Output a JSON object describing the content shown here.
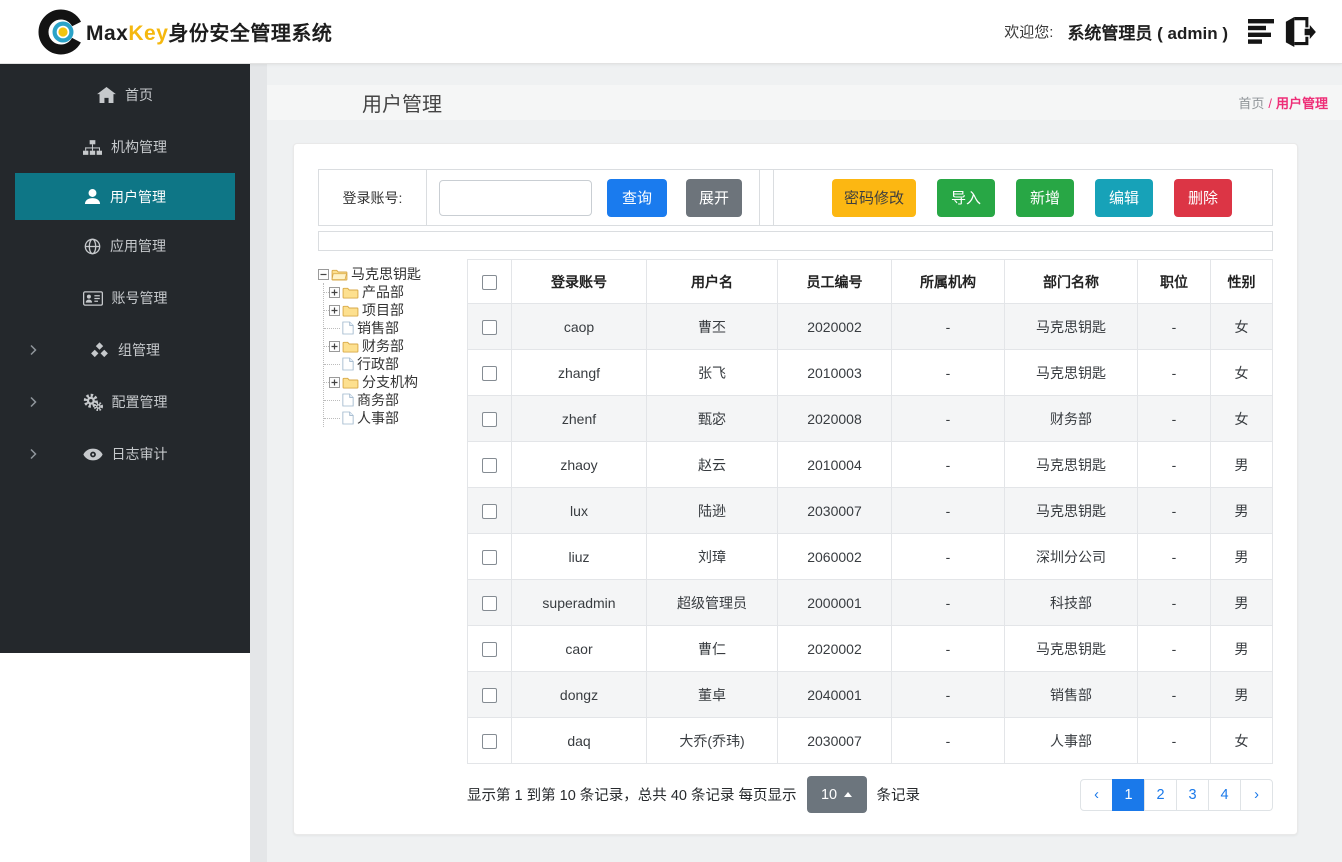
{
  "header": {
    "brand_max": "Max",
    "brand_key": "Key",
    "brand_suffix": "身份安全管理系统",
    "welcome": "欢迎您:",
    "user": "系统管理员 ( admin )"
  },
  "sidebar": {
    "items": [
      {
        "id": "home",
        "label": "首页",
        "icon": "home",
        "active": false,
        "expandable": false
      },
      {
        "id": "org",
        "label": "机构管理",
        "icon": "sitemap",
        "active": false,
        "expandable": false
      },
      {
        "id": "user",
        "label": "用户管理",
        "icon": "user",
        "active": true,
        "expandable": false
      },
      {
        "id": "app",
        "label": "应用管理",
        "icon": "globe",
        "active": false,
        "expandable": false
      },
      {
        "id": "account",
        "label": "账号管理",
        "icon": "idcard",
        "active": false,
        "expandable": false
      },
      {
        "id": "group",
        "label": "组管理",
        "icon": "cubes",
        "active": false,
        "expandable": true
      },
      {
        "id": "config",
        "label": "配置管理",
        "icon": "gears",
        "active": false,
        "expandable": true
      },
      {
        "id": "audit",
        "label": "日志审计",
        "icon": "eye",
        "active": false,
        "expandable": true
      }
    ]
  },
  "page": {
    "title": "用户管理",
    "breadcrumb_home": "首页",
    "breadcrumb_sep": "/",
    "breadcrumb_current": "用户管理"
  },
  "filter": {
    "label": "登录账号:",
    "search_value": "",
    "query_label": "查询",
    "expand_label": "展开",
    "actions": [
      {
        "id": "change-password",
        "label": "密码修改",
        "bg": "#fcb712",
        "fg": "#3f3f3f"
      },
      {
        "id": "import",
        "label": "导入",
        "bg": "#28a745",
        "fg": "#ffffff"
      },
      {
        "id": "add",
        "label": "新增",
        "bg": "#28a745",
        "fg": "#ffffff"
      },
      {
        "id": "edit",
        "label": "编辑",
        "bg": "#17a2b8",
        "fg": "#ffffff"
      },
      {
        "id": "delete",
        "label": "删除",
        "bg": "#dc3545",
        "fg": "#ffffff"
      }
    ]
  },
  "tree": {
    "root": {
      "label": "马克思钥匙",
      "expander": "minus",
      "icon": "folder-open"
    },
    "children": [
      {
        "label": "产品部",
        "expander": "plus",
        "icon": "folder"
      },
      {
        "label": "项目部",
        "expander": "plus",
        "icon": "folder"
      },
      {
        "label": "销售部",
        "expander": null,
        "icon": "file"
      },
      {
        "label": "财务部",
        "expander": "plus",
        "icon": "folder"
      },
      {
        "label": "行政部",
        "expander": null,
        "icon": "file"
      },
      {
        "label": "分支机构",
        "expander": "plus",
        "icon": "folder"
      },
      {
        "label": "商务部",
        "expander": null,
        "icon": "file"
      },
      {
        "label": "人事部",
        "expander": null,
        "icon": "file"
      }
    ]
  },
  "table": {
    "columns": [
      "登录账号",
      "用户名",
      "员工编号",
      "所属机构",
      "部门名称",
      "职位",
      "性别"
    ],
    "rows": [
      [
        "caop",
        "曹丕",
        "2020002",
        "-",
        "马克思钥匙",
        "-",
        "女"
      ],
      [
        "zhangf",
        "张飞",
        "2010003",
        "-",
        "马克思钥匙",
        "-",
        "女"
      ],
      [
        "zhenf",
        "甄宓",
        "2020008",
        "-",
        "财务部",
        "-",
        "女"
      ],
      [
        "zhaoy",
        "赵云",
        "2010004",
        "-",
        "马克思钥匙",
        "-",
        "男"
      ],
      [
        "lux",
        "陆逊",
        "2030007",
        "-",
        "马克思钥匙",
        "-",
        "男"
      ],
      [
        "liuz",
        "刘璋",
        "2060002",
        "-",
        "深圳分公司",
        "-",
        "男"
      ],
      [
        "superadmin",
        "超级管理员",
        "2000001",
        "-",
        "科技部",
        "-",
        "男"
      ],
      [
        "caor",
        "曹仁",
        "2020002",
        "-",
        "马克思钥匙",
        "-",
        "男"
      ],
      [
        "dongz",
        "董卓",
        "2040001",
        "-",
        "销售部",
        "-",
        "男"
      ],
      [
        "daq",
        "大乔(乔玮)",
        "2030007",
        "-",
        "人事部",
        "-",
        "女"
      ]
    ]
  },
  "pagination": {
    "info_prefix": "显示第 1 到第 10 条记录，总共 40 条记录  每页显示",
    "page_size": "10",
    "info_suffix": "条记录",
    "prev": "‹",
    "next": "›",
    "pages": [
      "1",
      "2",
      "3",
      "4"
    ],
    "active_page": "1"
  },
  "colors": {
    "sidebar_active": "#0e7686",
    "primary_blue": "#1a7bee",
    "breadcrumb_pink": "#ee2e77",
    "brand_yellow": "#f5b80f",
    "warning_yellow": "#fcb712",
    "success_green": "#28a745",
    "info_teal": "#17a2b8",
    "danger_red": "#dc3545"
  }
}
